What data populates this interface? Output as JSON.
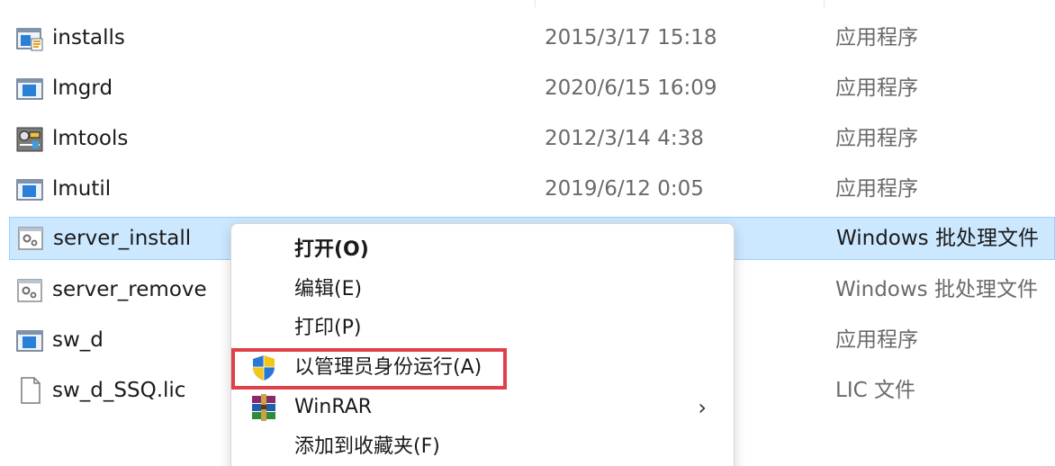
{
  "colors": {
    "selection_bg": "#cce8ff",
    "selection_border": "#99d1ff",
    "highlight": "#e0404a",
    "secondary_text": "#6a6a6a"
  },
  "files": [
    {
      "name": "installs",
      "date": "2015/3/17 15:18",
      "type": "应用程序",
      "icon": "setup-app-icon"
    },
    {
      "name": "lmgrd",
      "date": "2020/6/15 16:09",
      "type": "应用程序",
      "icon": "app-window-icon"
    },
    {
      "name": "lmtools",
      "date": "2012/3/14 4:38",
      "type": "应用程序",
      "icon": "lmtools-app-icon"
    },
    {
      "name": "lmutil",
      "date": "2019/6/12 0:05",
      "type": "应用程序",
      "icon": "app-window-icon"
    },
    {
      "name": "server_install",
      "date": "",
      "type": "Windows 批处理文件",
      "icon": "batch-file-icon"
    },
    {
      "name": "server_remove",
      "date": "",
      "type": "Windows 批处理文件",
      "icon": "batch-file-icon"
    },
    {
      "name": "sw_d",
      "date": "",
      "type": "应用程序",
      "icon": "app-window-icon"
    },
    {
      "name": "sw_d_SSQ.lic",
      "date": "",
      "type": "LIC 文件",
      "icon": "blank-file-icon"
    }
  ],
  "context_menu": {
    "items": [
      {
        "label": "打开(O)",
        "icon": ""
      },
      {
        "label": "编辑(E)",
        "icon": ""
      },
      {
        "label": "打印(P)",
        "icon": ""
      },
      {
        "label": "以管理员身份运行(A)",
        "icon": "uac-shield-icon"
      },
      {
        "label": "WinRAR",
        "icon": "winrar-icon",
        "submenu": "›"
      },
      {
        "label": "添加到收藏夹(F)",
        "icon": ""
      }
    ]
  }
}
